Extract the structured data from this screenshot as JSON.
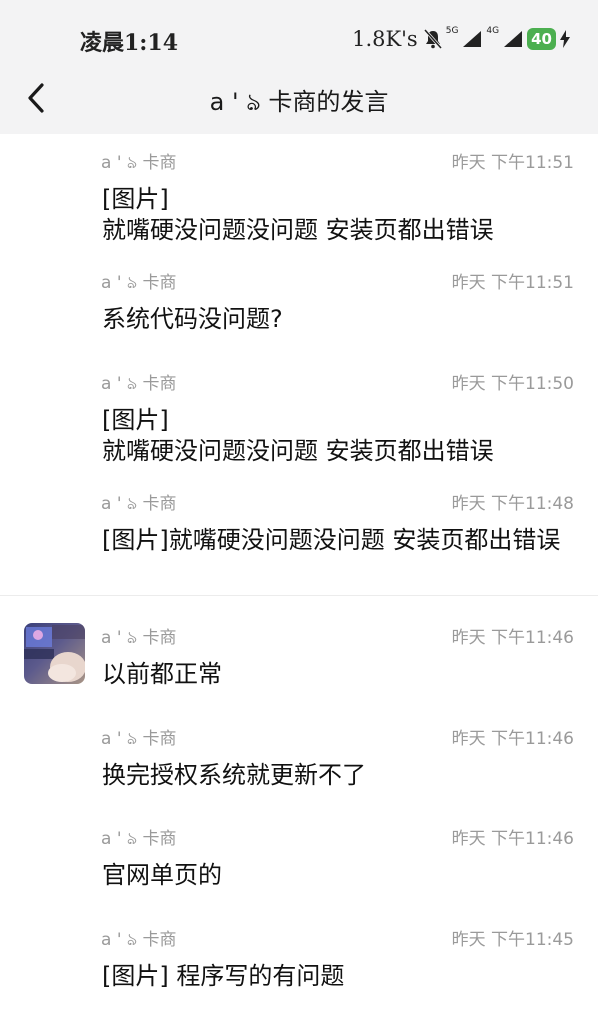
{
  "status_bar": {
    "time": "凌晨1:14",
    "net_speed": "1.8K's",
    "sig1_label": "5G",
    "sig2_label": "4G",
    "battery": "40",
    "icons": [
      "mute-bell-icon",
      "signal-icon",
      "signal-icon",
      "charging-icon"
    ]
  },
  "nav": {
    "back_icon": "chevron-left-icon",
    "title": "a ' ঌ 卡商的发言"
  },
  "messages": [
    {
      "name": "a ' ঌ 卡商",
      "time": "昨天 下午11:51",
      "text": "[图片]\n就嘴硬没问题没问题 安装页都出错误"
    },
    {
      "name": "a ' ঌ 卡商",
      "time": "昨天 下午11:51",
      "text": "系统代码没问题?"
    },
    {
      "name": "a ' ঌ 卡商",
      "time": "昨天 下午11:50",
      "text": "[图片]\n就嘴硬没问题没问题 安装页都出错误"
    },
    {
      "name": "a ' ঌ 卡商",
      "time": "昨天 下午11:48",
      "text": "[图片]就嘴硬没问题没问题 安装页都出错误"
    },
    {
      "name": "a ' ঌ 卡商",
      "time": "昨天 下午11:46",
      "text": "以前都正常"
    },
    {
      "name": "a ' ঌ 卡商",
      "time": "昨天 下午11:46",
      "text": "换完授权系统就更新不了"
    },
    {
      "name": "a ' ঌ 卡商",
      "time": "昨天 下午11:46",
      "text": "官网单页的"
    },
    {
      "name": "a ' ঌ 卡商",
      "time": "昨天 下午11:45",
      "text": "[图片] 程序写的有问题"
    }
  ],
  "colors": {
    "header_bg": "#f3f3f4",
    "meta_text": "#9a9a9a",
    "battery": "#4caf50"
  }
}
